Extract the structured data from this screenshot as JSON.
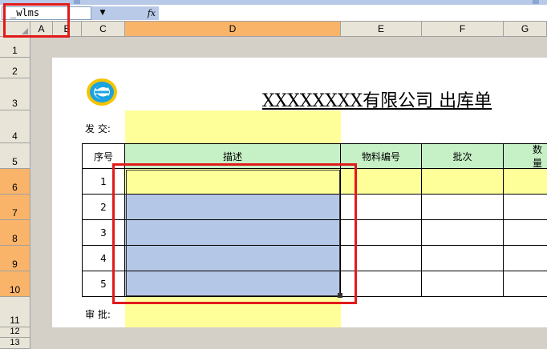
{
  "formula_bar": {
    "name_box": "_wlms",
    "dropdown": "▼",
    "fx": "fx",
    "formula": ""
  },
  "columns": [
    "A",
    "B",
    "C",
    "D",
    "E",
    "F",
    "G"
  ],
  "rows": [
    "1",
    "2",
    "3",
    "4",
    "5",
    "6",
    "7",
    "8",
    "9",
    "10",
    "11",
    "12",
    "13"
  ],
  "sheet": {
    "title": "XXXXXXXX有限公司  出库单",
    "send_label": "发  交:",
    "approve_label": "审  批:",
    "table": {
      "headers": [
        "序号",
        "描述",
        "物料编号",
        "批次",
        "数量"
      ],
      "row_numbers": [
        "1",
        "2",
        "3",
        "4",
        "5"
      ]
    }
  },
  "colors": {
    "selected_header": "#f9b46a",
    "input_yellow": "#ffff99",
    "header_green": "#c6f0c6",
    "selection_blue": "#b5c7e6",
    "highlight_red": "#e11a1a"
  },
  "icons": {
    "logo": "e-logo-icon",
    "name_dropdown": "chevron-down-icon",
    "function": "fx-icon",
    "select_all": "select-all-corner"
  }
}
